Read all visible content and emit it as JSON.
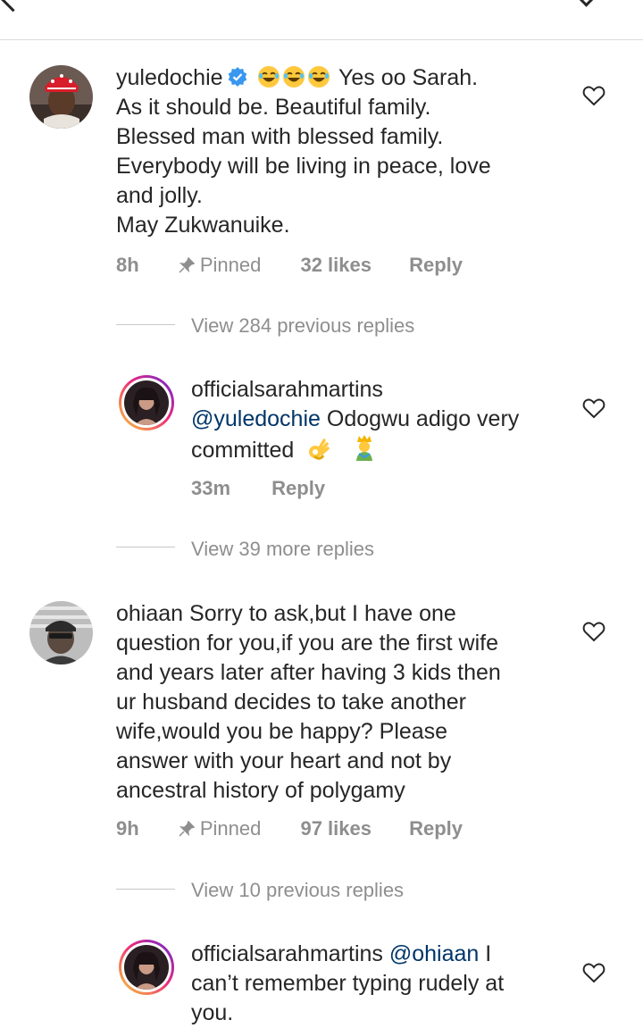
{
  "comments": [
    {
      "username": "yuledochie",
      "text_lead": "Yes oo Sarah.",
      "lines": [
        "As it should be. Beautiful family.",
        "Blessed man with blessed family.",
        "Everybody will be living in peace, love",
        "and jolly.",
        "May Zukwanuike."
      ],
      "time": "8h",
      "pinned_label": "Pinned",
      "likes": "32 likes",
      "reply_label": "Reply",
      "view_replies": "View 284 previous replies"
    },
    {
      "username": "officialsarahmartins",
      "mention": "@yuledochie",
      "text_after": " Odogwu adigo very",
      "line2": "committed",
      "time": "33m",
      "reply_label": "Reply",
      "view_replies": "View 39 more replies"
    },
    {
      "username": "ohiaan",
      "text_lead": "Sorry to ask,but I have one",
      "lines": [
        "question for you,if you are the first wife",
        "and years later after having 3 kids then",
        "ur husband decides to take another",
        "wife,would you be happy? Please",
        "answer with your heart  and not by",
        "ancestral history of polygamy"
      ],
      "time": "9h",
      "pinned_label": "Pinned",
      "likes": "97 likes",
      "reply_label": "Reply",
      "view_replies": "View 10 previous replies"
    },
    {
      "username": "officialsarahmartins",
      "mention": "@ohiaan",
      "text_after": " I",
      "lines": [
        "can’t remember typing rudely at",
        "you."
      ]
    }
  ],
  "colors": {
    "text": "#262626",
    "meta": "#8e8e8e",
    "mention": "#003569",
    "verified": "#3897f0"
  },
  "icons": [
    "back-arrow-icon",
    "chevron-down-icon",
    "verified-badge-icon",
    "laughing-emoji-icon",
    "ok-hand-emoji-icon",
    "prince-emoji-icon",
    "pin-icon",
    "heart-outline-icon"
  ]
}
